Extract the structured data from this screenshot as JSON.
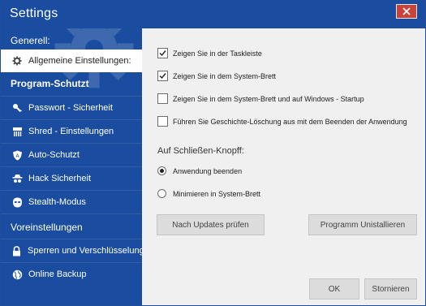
{
  "window": {
    "title": "Settings",
    "close_icon": "close-icon"
  },
  "sidebar": {
    "section1": "Generell:",
    "item_general": "Allgemeine Einstellungen:",
    "section2": "Program-Schutzt",
    "items_protect": [
      {
        "label": "Passwort - Sicherheit",
        "icon": "key-icon"
      },
      {
        "label": "Shred - Einstellungen",
        "icon": "shredder-icon"
      },
      {
        "label": "Auto-Schutzt",
        "icon": "shield-icon"
      },
      {
        "label": "Hack Sicherheit",
        "icon": "spy-icon"
      },
      {
        "label": "Stealth-Modus",
        "icon": "mask-icon"
      }
    ],
    "section3": "Voreinstellungen",
    "items_presets": [
      {
        "label": "Sperren und Verschlüsselung",
        "icon": "lock-icon"
      },
      {
        "label": "Online Backup",
        "icon": "globe-icon"
      }
    ]
  },
  "content": {
    "checkboxes": [
      {
        "label": "Zeigen Sie in der Taskleiste",
        "checked": true
      },
      {
        "label": "Zeigen Sie in dem System-Brett",
        "checked": true
      },
      {
        "label": "Zeigen Sie in dem System-Brett und auf Windows - Startup",
        "checked": false
      },
      {
        "label": "Führen Sie Geschichte-Löschung aus mit dem Beenden der Anwendung",
        "checked": false
      }
    ],
    "close_group_label": "Auf Schließen-Knopff:",
    "radios": [
      {
        "label": "Anwendung beenden",
        "selected": true
      },
      {
        "label": "Minimieren in System-Brett",
        "selected": false
      }
    ],
    "buttons": {
      "check_updates": "Nach Updates prüfen",
      "uninstall": "Programm Unistallieren",
      "ok": "OK",
      "cancel": "Stornieren"
    }
  },
  "colors": {
    "sidebar": "#1a4c9f",
    "close": "#c8443b",
    "content_bg": "#f0f0f0"
  }
}
